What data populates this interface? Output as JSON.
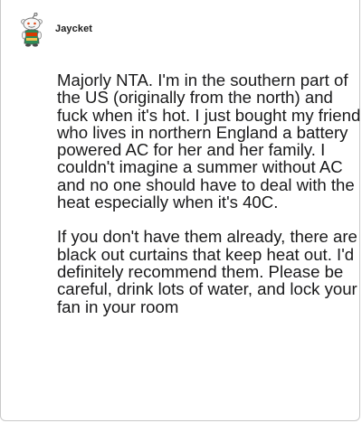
{
  "comment": {
    "username": "Jaycket",
    "avatar_icon": "snoo-avatar-icon",
    "paragraphs": [
      "Majorly NTA. I'm in the southern part of the US (originally from the north) and fuck when it's hot. I just bought my friend who lives in northern England a battery powered AC for her and her family. I couldn't imagine a summer without AC and no one should have to deal with the heat especially when it's 40C.",
      "If you don't have them already, there are black out curtains that keep heat out. I'd definitely recommend them. Please be careful, drink lots of water, and lock your fan in your room"
    ]
  },
  "colors": {
    "text": "#1a1a1b",
    "border": "#c9c9c9",
    "avatar_shirt_red": "#d93a00",
    "avatar_shirt_green": "#2e8b57"
  }
}
